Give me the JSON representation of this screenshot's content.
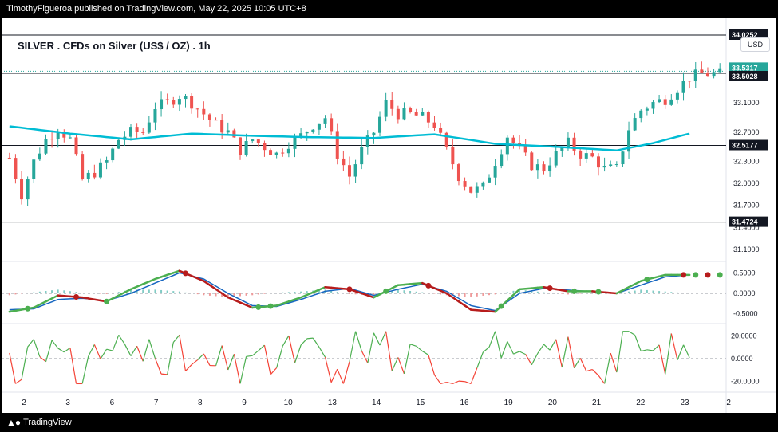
{
  "header": {
    "text": "TimothyFigueroa published on TradingView.com, May 22, 2025 10:05 UTC+8"
  },
  "title": "SILVER . CFDs on Silver (US$ / OZ) . 1h",
  "currency_button": "USD",
  "footer": {
    "brand": "TradingView",
    "logo": "tradingview-logo-icon"
  },
  "colors": {
    "up": "#26a69a",
    "down": "#ef5350",
    "ma": "#00bcd4",
    "macd_fast": "#4caf50",
    "macd_slow": "#1565c0",
    "macd_dark": "#b71c1c",
    "osc_up": "#4caf50",
    "osc_down": "#f44336",
    "label_teal": "#26a69a"
  },
  "chart_data": {
    "type": "candlestick",
    "x_ticks": [
      "2",
      "3",
      "6",
      "7",
      "8",
      "9",
      "10",
      "13",
      "14",
      "15",
      "16",
      "19",
      "20",
      "21",
      "22",
      "23",
      "2"
    ],
    "price_axis": {
      "ticks": [
        "33.1000",
        "32.7000",
        "32.3000",
        "32.0000",
        "31.7000",
        "31.4000",
        "31.1000"
      ],
      "ylim": [
        31.0,
        34.2
      ]
    },
    "horizontal_lines": [
      {
        "value": 34.0252,
        "label": "34.0252"
      },
      {
        "value": 33.5028,
        "label": "33.5028"
      },
      {
        "value": 32.5177,
        "label": "32.5177"
      },
      {
        "value": 31.4724,
        "label": "31.4724"
      }
    ],
    "last_price": {
      "value": 33.5317,
      "label": "33.5317"
    },
    "price_path": [
      [
        0,
        32.35
      ],
      [
        2,
        31.85
      ],
      [
        4,
        32.3
      ],
      [
        6,
        32.6
      ],
      [
        8,
        32.75
      ],
      [
        10,
        32.6
      ],
      [
        12,
        32.05
      ],
      [
        14,
        32.15
      ],
      [
        16,
        32.3
      ],
      [
        18,
        32.6
      ],
      [
        20,
        32.7
      ],
      [
        22,
        32.7
      ],
      [
        24,
        33.05
      ],
      [
        26,
        33.1
      ],
      [
        28,
        33.2
      ],
      [
        30,
        33.1
      ],
      [
        32,
        32.95
      ],
      [
        34,
        32.8
      ],
      [
        36,
        32.7
      ],
      [
        38,
        32.45
      ],
      [
        40,
        32.6
      ],
      [
        42,
        32.5
      ],
      [
        44,
        32.4
      ],
      [
        46,
        32.55
      ],
      [
        48,
        32.65
      ],
      [
        50,
        32.8
      ],
      [
        52,
        32.9
      ],
      [
        54,
        32.4
      ],
      [
        56,
        32.1
      ],
      [
        58,
        32.45
      ],
      [
        60,
        32.7
      ],
      [
        62,
        33.1
      ],
      [
        64,
        32.95
      ],
      [
        66,
        32.95
      ],
      [
        68,
        32.9
      ],
      [
        70,
        32.8
      ],
      [
        72,
        32.45
      ],
      [
        74,
        32.1
      ],
      [
        76,
        31.9
      ],
      [
        78,
        31.95
      ],
      [
        80,
        32.3
      ],
      [
        82,
        32.65
      ],
      [
        84,
        32.45
      ],
      [
        86,
        32.25
      ],
      [
        88,
        32.2
      ],
      [
        90,
        32.4
      ],
      [
        92,
        32.55
      ],
      [
        94,
        32.4
      ],
      [
        96,
        32.35
      ],
      [
        98,
        32.2
      ],
      [
        100,
        32.2
      ],
      [
        102,
        32.75
      ],
      [
        104,
        33.0
      ],
      [
        106,
        33.1
      ],
      [
        108,
        33.15
      ],
      [
        110,
        33.3
      ],
      [
        112,
        33.45
      ],
      [
        114,
        33.5
      ]
    ],
    "ma_path": [
      [
        0,
        32.78
      ],
      [
        10,
        32.68
      ],
      [
        20,
        32.6
      ],
      [
        30,
        32.68
      ],
      [
        40,
        32.65
      ],
      [
        50,
        32.63
      ],
      [
        60,
        32.62
      ],
      [
        70,
        32.67
      ],
      [
        80,
        32.54
      ],
      [
        90,
        32.5
      ],
      [
        100,
        32.45
      ],
      [
        106,
        32.55
      ],
      [
        112,
        32.68
      ]
    ],
    "macd": {
      "ticks": [
        "0.5000",
        "0.0000",
        "-0.5000"
      ],
      "ylim": [
        -0.7,
        0.7
      ],
      "fast": [
        [
          0,
          -0.45
        ],
        [
          4,
          -0.35
        ],
        [
          8,
          -0.05
        ],
        [
          12,
          -0.1
        ],
        [
          16,
          -0.2
        ],
        [
          20,
          0.1
        ],
        [
          24,
          0.35
        ],
        [
          28,
          0.55
        ],
        [
          32,
          0.3
        ],
        [
          36,
          -0.1
        ],
        [
          40,
          -0.35
        ],
        [
          44,
          -0.3
        ],
        [
          48,
          -0.1
        ],
        [
          52,
          0.15
        ],
        [
          56,
          0.1
        ],
        [
          60,
          -0.1
        ],
        [
          64,
          0.2
        ],
        [
          68,
          0.25
        ],
        [
          72,
          0.0
        ],
        [
          76,
          -0.4
        ],
        [
          80,
          -0.45
        ],
        [
          84,
          0.1
        ],
        [
          88,
          0.15
        ],
        [
          92,
          0.05
        ],
        [
          96,
          0.05
        ],
        [
          100,
          0.0
        ],
        [
          104,
          0.3
        ],
        [
          108,
          0.45
        ],
        [
          112,
          0.45
        ]
      ],
      "slow": [
        [
          0,
          -0.4
        ],
        [
          4,
          -0.38
        ],
        [
          8,
          -0.15
        ],
        [
          12,
          -0.12
        ],
        [
          16,
          -0.18
        ],
        [
          20,
          0.0
        ],
        [
          24,
          0.25
        ],
        [
          28,
          0.5
        ],
        [
          32,
          0.35
        ],
        [
          36,
          0.0
        ],
        [
          40,
          -0.3
        ],
        [
          44,
          -0.32
        ],
        [
          48,
          -0.15
        ],
        [
          52,
          0.05
        ],
        [
          56,
          0.12
        ],
        [
          60,
          -0.05
        ],
        [
          64,
          0.1
        ],
        [
          68,
          0.22
        ],
        [
          72,
          0.05
        ],
        [
          76,
          -0.3
        ],
        [
          80,
          -0.42
        ],
        [
          84,
          0.0
        ],
        [
          88,
          0.12
        ],
        [
          92,
          0.08
        ],
        [
          96,
          0.04
        ],
        [
          100,
          0.0
        ],
        [
          104,
          0.2
        ],
        [
          108,
          0.4
        ],
        [
          112,
          0.45
        ]
      ],
      "markers": [
        {
          "x": 3,
          "color": "green"
        },
        {
          "x": 11,
          "color": "red"
        },
        {
          "x": 16,
          "color": "green"
        },
        {
          "x": 29,
          "color": "red"
        },
        {
          "x": 41,
          "color": "green"
        },
        {
          "x": 43,
          "color": "green"
        },
        {
          "x": 56,
          "color": "red"
        },
        {
          "x": 62,
          "color": "green"
        },
        {
          "x": 69,
          "color": "red"
        },
        {
          "x": 81,
          "color": "green"
        },
        {
          "x": 89,
          "color": "red"
        },
        {
          "x": 93,
          "color": "green"
        },
        {
          "x": 97,
          "color": "green"
        },
        {
          "x": 105,
          "color": "green"
        },
        {
          "x": 111,
          "color": "red"
        },
        {
          "x": 113,
          "color": "green"
        },
        {
          "x": 115,
          "color": "red"
        },
        {
          "x": 117,
          "color": "green"
        }
      ]
    },
    "oscillator": {
      "ticks": [
        "20.0000",
        "0.0000",
        "-20.0000"
      ],
      "ylim": [
        -28,
        28
      ]
    }
  }
}
